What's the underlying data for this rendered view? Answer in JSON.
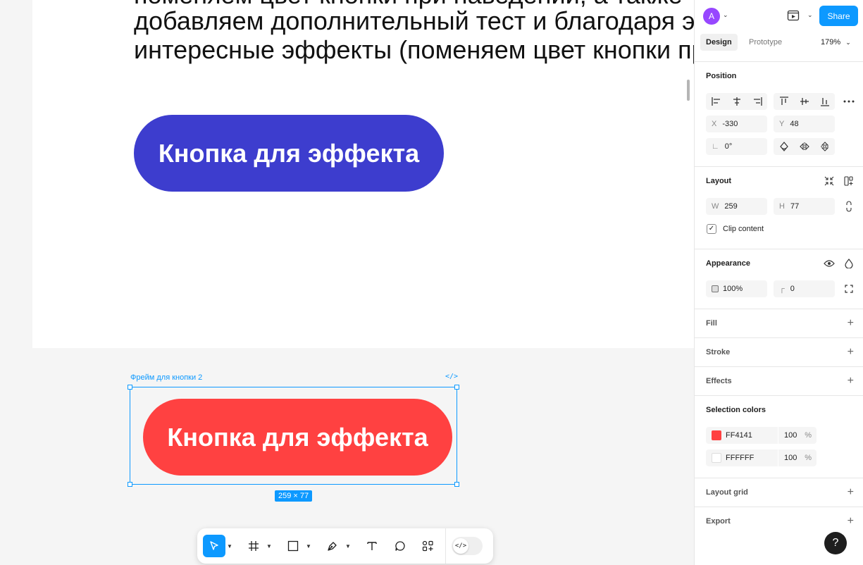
{
  "canvas": {
    "text_lines": [
      "поменяем цвет кнопки при наведении, а также",
      "добавляем дополнительный тест и благодаря этому получим",
      "интересные эффекты (поменяем цвет кнопки при наведении)"
    ],
    "blue_button_label": "Кнопка для эффекта",
    "frame_label": "Фрейм для кнопки 2",
    "red_button_label": "Кнопка для эффекта",
    "size_badge": "259 × 77",
    "colors": {
      "blue_button": "#3d3dce",
      "red_button": "#ff4141",
      "selection": "#0d99ff"
    }
  },
  "toolbar": {
    "tools": [
      "move-tool",
      "frame-tool",
      "shape-tool",
      "pen-tool",
      "text-tool",
      "comment-tool",
      "actions-tool"
    ],
    "active_tool": "move-tool",
    "dev_mode_icon": "</>"
  },
  "panel": {
    "avatar_initial": "A",
    "share_label": "Share",
    "tabs": {
      "design": "Design",
      "prototype": "Prototype"
    },
    "zoom": "179%",
    "position": {
      "title": "Position",
      "x_label": "X",
      "x_value": "-330",
      "y_label": "Y",
      "y_value": "48",
      "rotation_value": "0°"
    },
    "layout": {
      "title": "Layout",
      "w_label": "W",
      "w_value": "259",
      "h_label": "H",
      "h_value": "77",
      "clip_content_label": "Clip content",
      "clip_content_checked": true
    },
    "appearance": {
      "title": "Appearance",
      "opacity": "100%",
      "corner_radius": "0"
    },
    "fill_title": "Fill",
    "stroke_title": "Stroke",
    "effects_title": "Effects",
    "selection_colors": {
      "title": "Selection colors",
      "items": [
        {
          "hex": "FF4141",
          "swatch": "#ff4141",
          "opacity": "100",
          "unit": "%"
        },
        {
          "hex": "FFFFFF",
          "swatch": "#ffffff",
          "opacity": "100",
          "unit": "%"
        }
      ]
    },
    "layout_grid_title": "Layout grid",
    "export_title": "Export",
    "help_label": "?"
  }
}
